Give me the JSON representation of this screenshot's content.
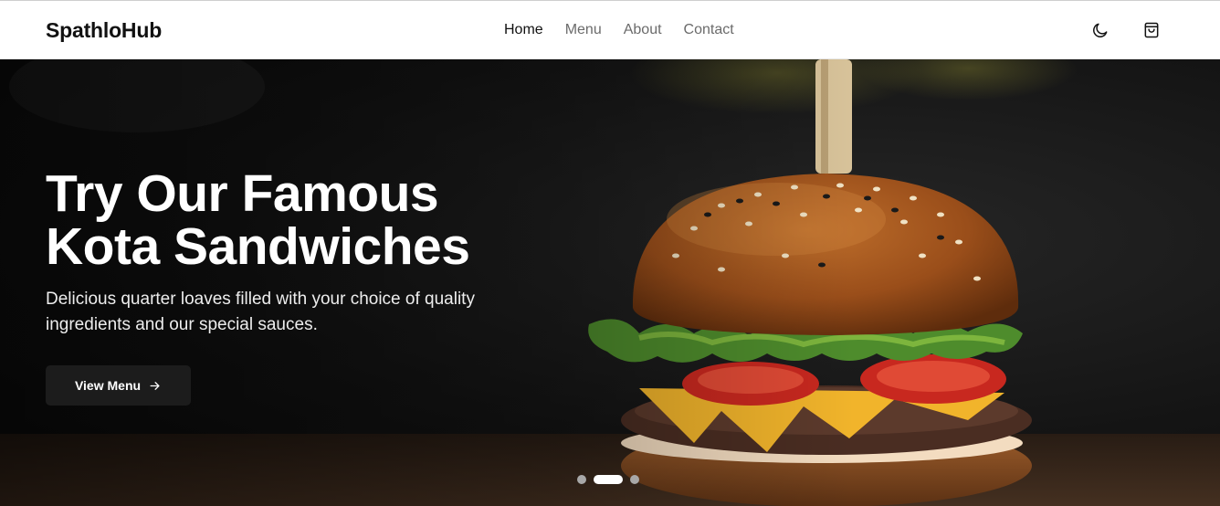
{
  "brand": {
    "name": "SpathloHub"
  },
  "nav": {
    "links": [
      {
        "label": "Home",
        "active": true
      },
      {
        "label": "Menu",
        "active": false
      },
      {
        "label": "About",
        "active": false
      },
      {
        "label": "Contact",
        "active": false
      }
    ],
    "icons": [
      "moon-icon",
      "shopping-bag-icon"
    ]
  },
  "hero": {
    "title_line1": "Try Our Famous",
    "title_line2": "Kota Sandwiches",
    "subtitle_line1": "Delicious quarter loaves filled with your choice of quality",
    "subtitle_line2": "ingredients and our special sauces.",
    "cta_label": "View Menu",
    "cta_icon": "arrow-right-icon",
    "slide_count": 3,
    "active_slide": 2
  },
  "colors": {
    "navbar_bg": "#ffffff",
    "text_dark": "#111111",
    "nav_muted": "#6b6b6b",
    "hero_bg": "#141414",
    "button_bg": "#1c1c1c",
    "dot_active": "#ffffff",
    "dot_inactive": "#a8a8a8"
  }
}
